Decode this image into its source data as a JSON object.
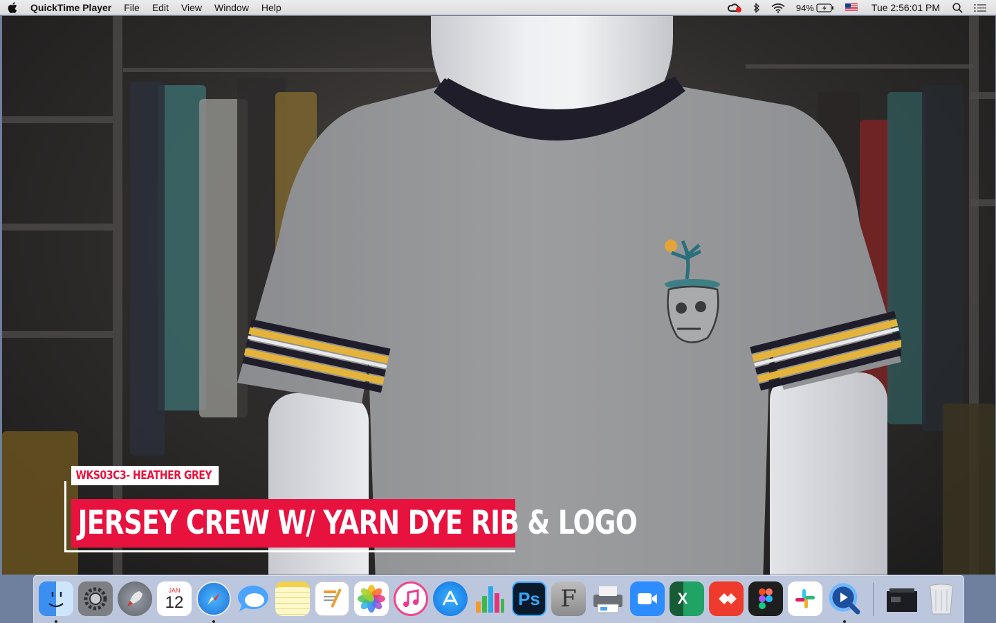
{
  "menubar": {
    "app_name": "QuickTime Player",
    "menus": [
      "File",
      "Edit",
      "View",
      "Window",
      "Help"
    ],
    "battery": "94%",
    "clock": "Tue 2:56:01 PM"
  },
  "video": {
    "code_label": "WKS03C3- HEATHER GREY",
    "title": "JERSEY CREW W/ YARN DYE RIB & LOGO"
  },
  "dock": {
    "calendar_month": "JAN",
    "calendar_day": "12",
    "ps_label": "Ps",
    "font_label": "F",
    "excel_label": "X"
  },
  "colors": {
    "accent_red": "#e8123f",
    "shirt_grey": "#9a9b9d",
    "stripe_yellow": "#e3b33b",
    "stripe_navy": "#1f1d2a"
  }
}
